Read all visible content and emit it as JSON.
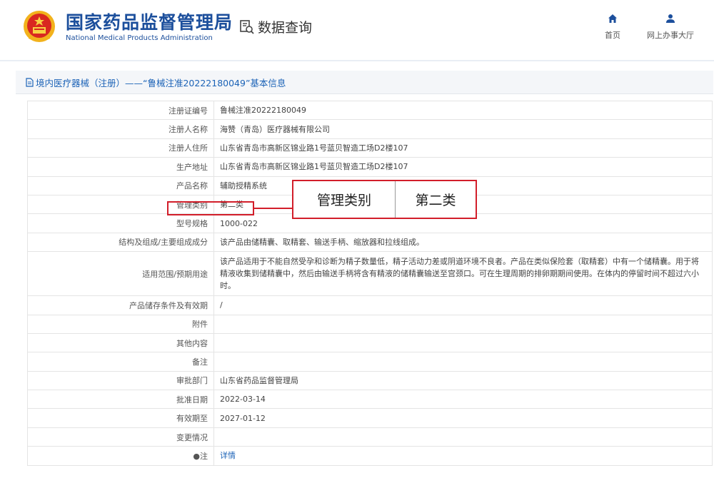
{
  "header": {
    "brand_cn": "国家药品监督管理局",
    "brand_en": "National Medical Products Administration",
    "query_label": "数据查询",
    "nav_home": "首页",
    "nav_hall": "网上办事大厅",
    "accent_color": "#1c4f9c"
  },
  "section": {
    "title": "境内医疗器械（注册）——“鲁械注准20222180049”基本信息"
  },
  "fields": [
    {
      "key": "注册证编号",
      "value": "鲁械注准20222180049"
    },
    {
      "key": "注册人名称",
      "value": "海赞（青岛）医疗器械有限公司"
    },
    {
      "key": "注册人住所",
      "value": "山东省青岛市高新区锦业路1号蓝贝智造工场D2楼107"
    },
    {
      "key": "生产地址",
      "value": "山东省青岛市高新区锦业路1号蓝贝智造工场D2楼107"
    },
    {
      "key": "产品名称",
      "value": "辅助授精系统"
    },
    {
      "key": "管理类别",
      "value": "第二类"
    },
    {
      "key": "型号规格",
      "value": "1000-022"
    },
    {
      "key": "结构及组成/主要组成成分",
      "value": "该产品由储精囊、取精套、输送手柄、缩放器和拉线组成。"
    },
    {
      "key": "适用范围/预期用途",
      "value": "该产品适用于不能自然受孕和诊断为精子数量低，精子活动力差或阴道环境不良者。产品在类似保险套（取精套）中有一个储精囊。用于将精液收集到储精囊中，然后由输送手柄将含有精液的储精囊输送至宫颈口。可在生理周期的排卵期期间使用。在体内的停留时间不超过六小时。"
    },
    {
      "key": "产品储存条件及有效期",
      "value": "/"
    },
    {
      "key": "附件",
      "value": ""
    },
    {
      "key": "其他内容",
      "value": ""
    },
    {
      "key": "备注",
      "value": ""
    },
    {
      "key": "审批部门",
      "value": "山东省药品监督管理局"
    },
    {
      "key": "批准日期",
      "value": "2022-03-14"
    },
    {
      "key": "有效期至",
      "value": "2027-01-12"
    },
    {
      "key": "变更情况",
      "value": ""
    },
    {
      "key": "●注",
      "value": "详情"
    }
  ],
  "callout": {
    "label": "管理类别",
    "value": "第二类",
    "color": "#d21e2a"
  }
}
